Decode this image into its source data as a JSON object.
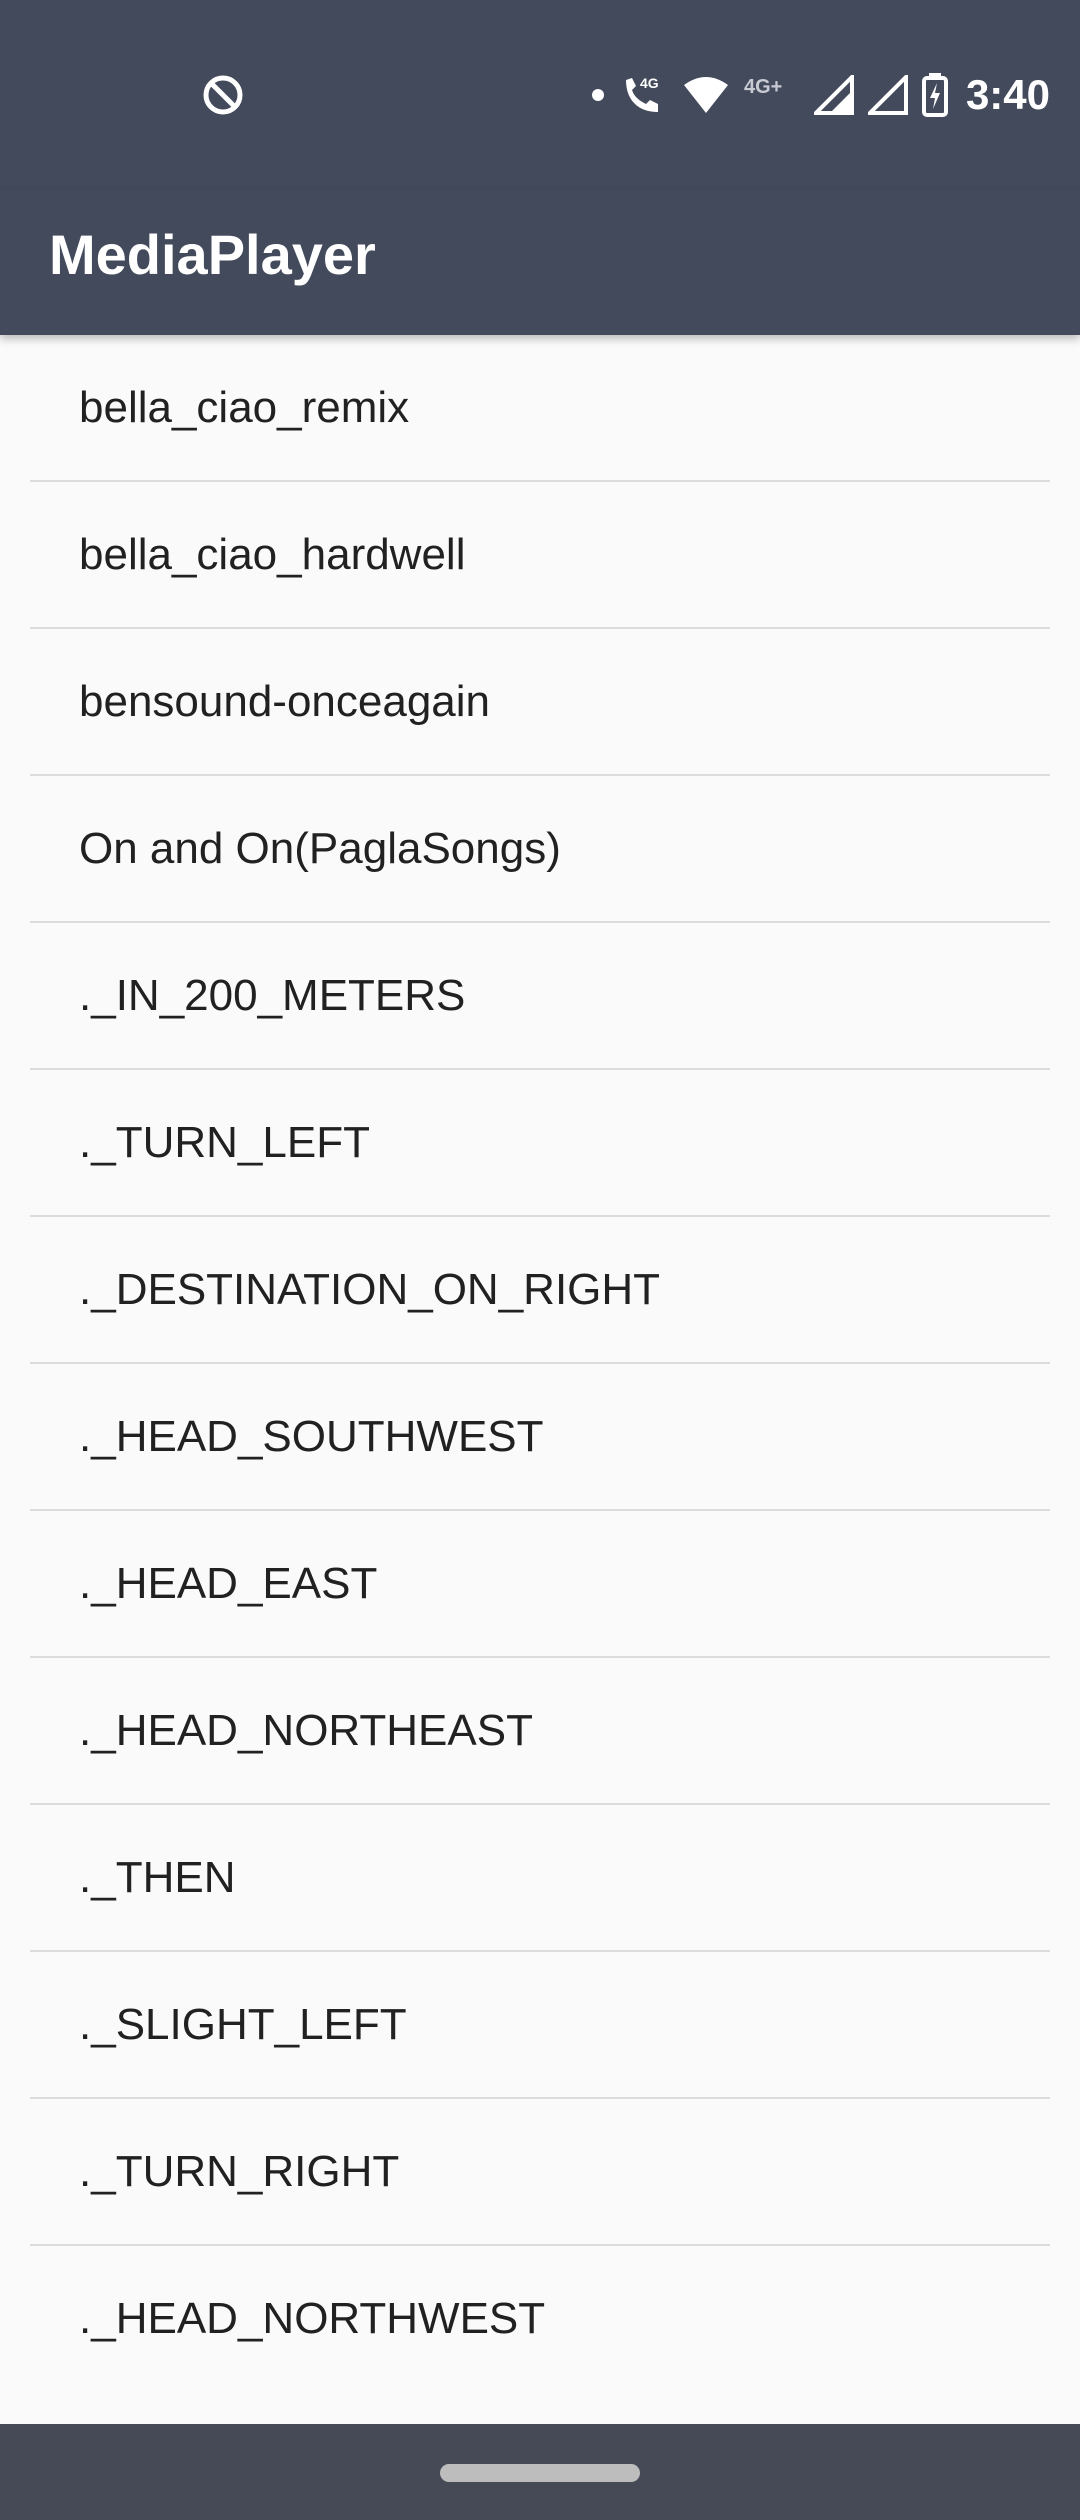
{
  "status_bar": {
    "time": "3:40",
    "network_label_primary": "4G",
    "network_label_secondary": "4G+"
  },
  "app_bar": {
    "title": "MediaPlayer"
  },
  "songs": [
    "bella_ciao_remix",
    "bella_ciao_hardwell",
    "bensound-onceagain",
    "On and On(PaglaSongs)",
    "._IN_200_METERS",
    "._TURN_LEFT",
    "._DESTINATION_ON_RIGHT",
    "._HEAD_SOUTHWEST",
    "._HEAD_EAST",
    "._HEAD_NORTHEAST",
    "._THEN",
    "._SLIGHT_LEFT",
    "._TURN_RIGHT",
    "._HEAD_NORTHWEST"
  ],
  "colors": {
    "app_bar": "#434a5c",
    "background": "#fafafa",
    "divider": "#dcdcdc",
    "text": "#212121",
    "nav_bar": "#454a56"
  }
}
